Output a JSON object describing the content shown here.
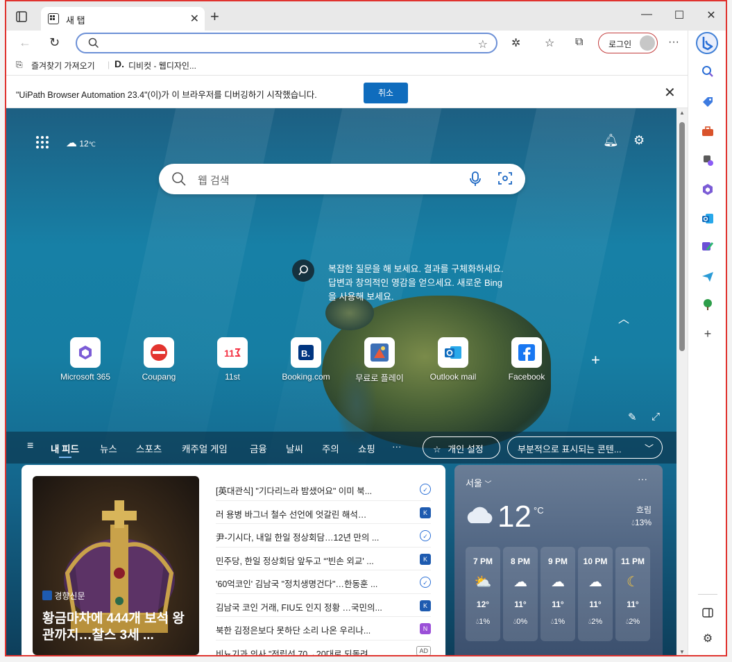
{
  "tab": {
    "title": "새 탭"
  },
  "navbar": {
    "login_label": "로그인"
  },
  "bookmarks": [
    {
      "label": "즐겨찾기 가져오기"
    },
    {
      "label": "디비컷 - 웹디자인..."
    }
  ],
  "infobar": {
    "message": "\"UiPath Browser Automation 23.4\"(이)가 이 브라우저를 디버깅하기 시작했습니다.",
    "cancel_label": "취소"
  },
  "hero": {
    "weather_temp": "12",
    "weather_unit": "℃",
    "search_placeholder": "웹 검색",
    "bing_tip": "복잡한 질문을 해 보세요. 결과를 구체화하세요. 답변과 창의적인 영감을 얻으세요. 새로운 Bing을 사용해 보세요."
  },
  "quick_links": [
    {
      "label": "Microsoft 365"
    },
    {
      "label": "Coupang"
    },
    {
      "label": "11st"
    },
    {
      "label": "Booking.com"
    },
    {
      "label": "무료로 플레이"
    },
    {
      "label": "Outlook mail"
    },
    {
      "label": "Facebook"
    }
  ],
  "feed_nav": {
    "items": [
      "내 피드",
      "뉴스",
      "스포츠",
      "캐주얼 게임",
      "금융",
      "날씨",
      "주의",
      "쇼핑",
      "···"
    ],
    "personalize": "개인 설정",
    "content_mode": "부분적으로 표시되는 콘텐..."
  },
  "news": {
    "hero_source": "경향신문",
    "hero_title": "황금마차에 444개 보석 왕관까지…찰스 3세 ...",
    "items": [
      {
        "title": "[英대관식] \"기다리느라 밤샜어요\" 이미 북...",
        "badge": "blue-shield"
      },
      {
        "title": "러 용병 바그너 철수 선언에 엇갈린 해석…",
        "badge": "kh"
      },
      {
        "title": "尹-기시다, 내일 한일 정상회담…12년 만의 ...",
        "badge": "blue-shield"
      },
      {
        "title": "민주당, 한일 정상회담 앞두고 “'빈손 외교' ...",
        "badge": "kh"
      },
      {
        "title": "'60억코인' 김남국 \"정치생명건다\"…한동훈 ...",
        "badge": "blue-shield"
      },
      {
        "title": "김남국 코인 거래, FIU도 인지 정황 …국민의...",
        "badge": "kh"
      },
      {
        "title": "북한 김정은보다 못하단 소리 나온 우리나...",
        "badge": "news-purple"
      },
      {
        "title": "비뇨기과 의사 \"전립선 70→20대로 되돌려 ...",
        "badge": "AD"
      }
    ]
  },
  "weather_card": {
    "city": "서울",
    "temp": "12",
    "unit": "°C",
    "condition": "흐림",
    "precip": "13%",
    "hours": [
      {
        "time": "7 PM",
        "temp": "12°",
        "precip": "1%"
      },
      {
        "time": "8 PM",
        "temp": "11°",
        "precip": "0%"
      },
      {
        "time": "9 PM",
        "temp": "11°",
        "precip": "1%"
      },
      {
        "time": "10 PM",
        "temp": "11°",
        "precip": "2%"
      },
      {
        "time": "11 PM",
        "temp": "11°",
        "precip": "2%"
      }
    ]
  }
}
